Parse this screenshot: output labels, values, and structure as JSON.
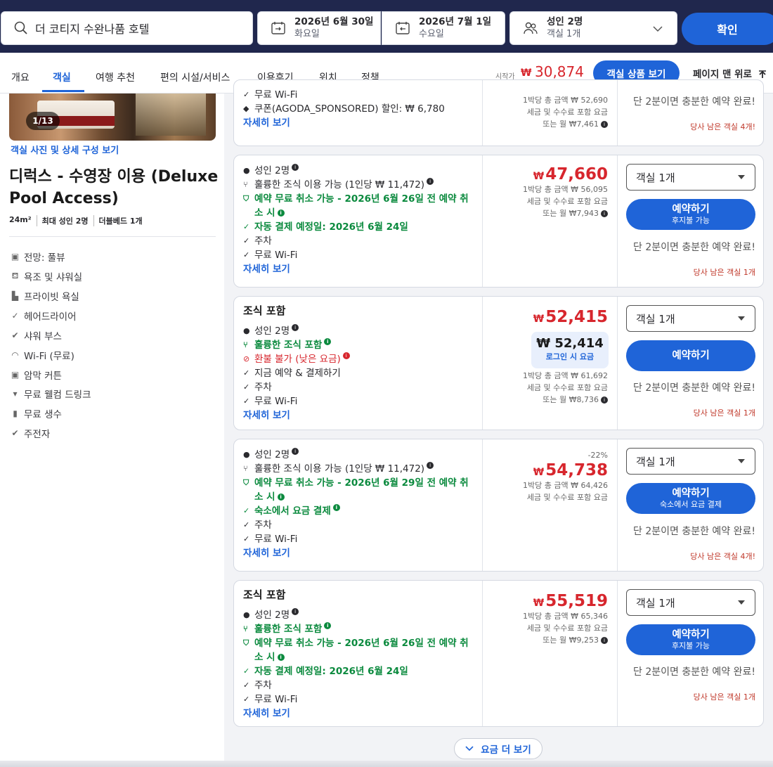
{
  "search": {
    "query": "더 코티지 수완나품 호텔",
    "checkin_date": "2026년 6월 30일",
    "checkin_day": "화요일",
    "checkout_date": "2026년 7월 1일",
    "checkout_day": "수요일",
    "guests_line1": "성인 2명",
    "guests_line2": "객실 1개",
    "confirm_label": "확인"
  },
  "nav": {
    "tabs": [
      "개요",
      "객실",
      "여행 추천",
      "편의 시설/서비스",
      "이용후기",
      "위치",
      "정책"
    ],
    "active_tab": "객실",
    "from_label": "시작가",
    "from_currency": "₩",
    "from_price": "30,874",
    "view_rooms_label": "객실 상품 보기",
    "back_to_top_label": "페이지 맨 위로"
  },
  "room": {
    "photo_count": "1/13",
    "photo_link": "객실 사진 및 상세 구성 보기",
    "title": "디럭스 - 수영장 이용 (Deluxe Pool Access)",
    "size": "24m²",
    "max_guests": "최대 성인 2명",
    "bed": "더블베드 1개",
    "amenities": [
      {
        "icon": "view-icon",
        "label": "전망: 풀뷰"
      },
      {
        "icon": "bathtub-icon",
        "label": "욕조 및 샤워실"
      },
      {
        "icon": "toilet-icon",
        "label": "프라이빗 욕실"
      },
      {
        "icon": "check-icon",
        "label": "헤어드라이어"
      },
      {
        "icon": "check-circle-icon",
        "label": "샤워 부스"
      },
      {
        "icon": "wifi-icon",
        "label": "Wi-Fi (무료)"
      },
      {
        "icon": "curtain-icon",
        "label": "암막 커튼"
      },
      {
        "icon": "drink-icon",
        "label": "무료 웰컴 드링크"
      },
      {
        "icon": "water-bottle-icon",
        "label": "무료 생수"
      },
      {
        "icon": "check-circle-icon",
        "label": "주전자"
      }
    ]
  },
  "common": {
    "more_link": "자세히 보기",
    "per_night_label": "1박당 총 금액",
    "tax_label": "세금 및 수수료 포함 요금",
    "monthly_prefix": "또는 월",
    "select_value": "객실 1개",
    "book_label": "예약하기",
    "urgency": "단 2분이면 충분한 예약 완료!",
    "breakfast_heading": "조식 포함",
    "show_more": "요금 더 보기",
    "currency": "₩"
  },
  "offers": [
    {
      "features": [
        "무료 Wi-Fi",
        "쿠폰(AGODA_SPONSORED) 할인: ₩ 6,780"
      ],
      "total": "₩ 52,690",
      "monthly": "₩7,461",
      "remaining": "당사 남은 객실 4개!"
    },
    {
      "guests": "성인 2명",
      "breakfast": "훌륭한 조식 이용 가능 (1인당 ₩ 11,472)",
      "cancel": "예약 무료 취소 가능 - 2026년 6월 26일 전 예약 취소 시",
      "payment": "자동 결제 예정일: 2026년 6월 24일",
      "parking": "주차",
      "wifi": "무료 Wi-Fi",
      "price": "47,660",
      "total": "₩ 56,095",
      "monthly": "₩7,943",
      "book_sub": "후지불 가능",
      "remaining": "당사 남은 객실 1개"
    },
    {
      "guests": "성인 2명",
      "breakfast": "훌륭한 조식 포함",
      "refund": "환불 불가 (낮은 요금)",
      "paynow": "지금 예약 & 결제하기",
      "parking": "주차",
      "wifi": "무료 Wi-Fi",
      "price": "52,415",
      "login_price": "₩ 52,414",
      "login_label": "로그인 시 요금",
      "total": "₩ 61,692",
      "monthly": "₩8,736",
      "remaining": "당사 남은 객실 1개"
    },
    {
      "guests": "성인 2명",
      "breakfast": "훌륭한 조식 이용 가능 (1인당 ₩ 11,472)",
      "cancel": "예약 무료 취소 가능 - 2026년 6월 29일 전 예약 취소 시",
      "payment": "숙소에서 요금 결제",
      "parking": "주차",
      "wifi": "무료 Wi-Fi",
      "discount": "-22%",
      "price": "54,738",
      "total": "₩ 64,426",
      "book_sub": "숙소에서 요금 결제",
      "remaining": "당사 남은 객실 4개!"
    },
    {
      "guests": "성인 2명",
      "breakfast": "훌륭한 조식 포함",
      "cancel": "예약 무료 취소 가능 - 2026년 6월 26일 전 예약 취소 시",
      "payment": "자동 결제 예정일: 2026년 6월 24일",
      "parking": "주차",
      "wifi": "무료 Wi-Fi",
      "price": "55,519",
      "total": "₩ 65,346",
      "monthly": "₩9,253",
      "book_sub": "후지불 가능",
      "remaining": "당사 남은 객실 1개"
    }
  ]
}
